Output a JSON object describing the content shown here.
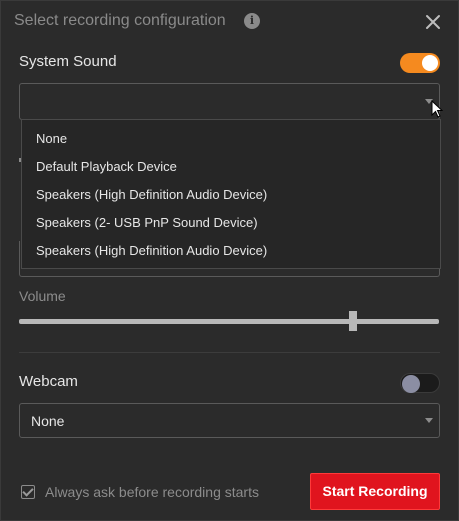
{
  "dialog": {
    "title": "Select recording configuration",
    "info_icon": "info-icon",
    "close_icon": "close-icon"
  },
  "system_sound": {
    "label": "System Sound",
    "toggle_on": true,
    "selected_value": "",
    "dropdown_open": true,
    "options": [
      "None",
      "Default Playback Device",
      "Speakers (High Definition Audio Device)",
      "Speakers (2- USB PnP Sound Device)",
      "Speakers (High Definition Audio Device)"
    ]
  },
  "volume": {
    "label": "Volume",
    "value_fraction": 0.8
  },
  "webcam": {
    "label": "Webcam",
    "toggle_on": false,
    "selected_value": "None"
  },
  "footer": {
    "ask_checkbox_checked": true,
    "ask_label": "Always ask before recording starts",
    "start_button_label": "Start Recording"
  },
  "colors": {
    "accent_orange": "#f58a1f",
    "start_red": "#e0141e",
    "background": "#2b2b2b"
  }
}
